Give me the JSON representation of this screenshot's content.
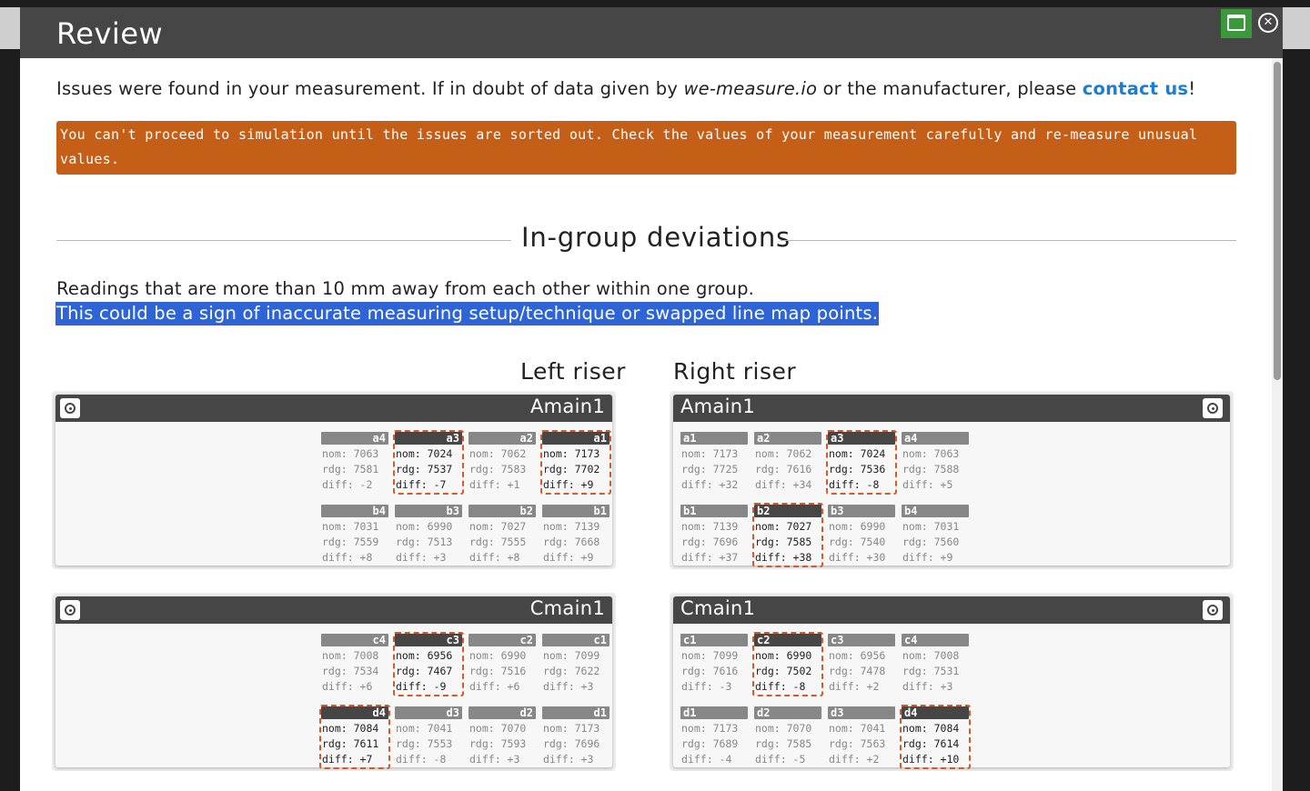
{
  "window": {
    "title": "Review",
    "maximize_icon": "window-maximize-icon",
    "close_icon": "close-circle-icon",
    "accent_green": "#3a9a3a",
    "header_bg": "#464646"
  },
  "intro": {
    "text1": "Issues were found in your measurement. If in doubt of data given by ",
    "source": "we-measure.io",
    "text2": " or the manufacturer, please ",
    "link": "contact us",
    "text3": "!"
  },
  "warning": {
    "text": "You can't proceed to simulation until the issues are sorted out. Check the values of your measurement carefully and re-measure unusual values.",
    "color": "#c55e16"
  },
  "section": {
    "title": "In-group deviations",
    "desc1": "Readings that are more than 10 mm away from each other within one group.",
    "desc2": "This could be a sign of inaccurate measuring setup/technique or swapped line map points."
  },
  "risers": {
    "left": "Left riser",
    "right": "Right riser"
  },
  "panels": {
    "left_amain": {
      "name": "Amain1",
      "rows": [
        [
          {
            "tag": "a4",
            "nom": "nom: 7063",
            "rdg": "rdg: 7581",
            "diff": "diff: -2",
            "bad": false
          },
          {
            "tag": "a3",
            "nom": "nom: 7024",
            "rdg": "rdg: 7537",
            "diff": "diff: -7",
            "bad": true
          },
          {
            "tag": "a2",
            "nom": "nom: 7062",
            "rdg": "rdg: 7583",
            "diff": "diff: +1",
            "bad": false
          },
          {
            "tag": "a1",
            "nom": "nom: 7173",
            "rdg": "rdg: 7702",
            "diff": "diff: +9",
            "bad": true
          }
        ],
        [
          {
            "tag": "b4",
            "nom": "nom: 7031",
            "rdg": "rdg: 7559",
            "diff": "diff: +8",
            "bad": false
          },
          {
            "tag": "b3",
            "nom": "nom: 6990",
            "rdg": "rdg: 7513",
            "diff": "diff: +3",
            "bad": false
          },
          {
            "tag": "b2",
            "nom": "nom: 7027",
            "rdg": "rdg: 7555",
            "diff": "diff: +8",
            "bad": false
          },
          {
            "tag": "b1",
            "nom": "nom: 7139",
            "rdg": "rdg: 7668",
            "diff": "diff: +9",
            "bad": false
          }
        ]
      ]
    },
    "right_amain": {
      "name": "Amain1",
      "rows": [
        [
          {
            "tag": "a1",
            "nom": "nom: 7173",
            "rdg": "rdg: 7725",
            "diff": "diff: +32",
            "bad": false
          },
          {
            "tag": "a2",
            "nom": "nom: 7062",
            "rdg": "rdg: 7616",
            "diff": "diff: +34",
            "bad": false
          },
          {
            "tag": "a3",
            "nom": "nom: 7024",
            "rdg": "rdg: 7536",
            "diff": "diff: -8",
            "bad": true
          },
          {
            "tag": "a4",
            "nom": "nom: 7063",
            "rdg": "rdg: 7588",
            "diff": "diff: +5",
            "bad": false
          }
        ],
        [
          {
            "tag": "b1",
            "nom": "nom: 7139",
            "rdg": "rdg: 7696",
            "diff": "diff: +37",
            "bad": false
          },
          {
            "tag": "b2",
            "nom": "nom: 7027",
            "rdg": "rdg: 7585",
            "diff": "diff: +38",
            "bad": true
          },
          {
            "tag": "b3",
            "nom": "nom: 6990",
            "rdg": "rdg: 7540",
            "diff": "diff: +30",
            "bad": false
          },
          {
            "tag": "b4",
            "nom": "nom: 7031",
            "rdg": "rdg: 7560",
            "diff": "diff: +9",
            "bad": false
          }
        ]
      ]
    },
    "left_cmain": {
      "name": "Cmain1",
      "rows": [
        [
          {
            "tag": "c4",
            "nom": "nom: 7008",
            "rdg": "rdg: 7534",
            "diff": "diff: +6",
            "bad": false
          },
          {
            "tag": "c3",
            "nom": "nom: 6956",
            "rdg": "rdg: 7467",
            "diff": "diff: -9",
            "bad": true
          },
          {
            "tag": "c2",
            "nom": "nom: 6990",
            "rdg": "rdg: 7516",
            "diff": "diff: +6",
            "bad": false
          },
          {
            "tag": "c1",
            "nom": "nom: 7099",
            "rdg": "rdg: 7622",
            "diff": "diff: +3",
            "bad": false
          }
        ],
        [
          {
            "tag": "d4",
            "nom": "nom: 7084",
            "rdg": "rdg: 7611",
            "diff": "diff: +7",
            "bad": true
          },
          {
            "tag": "d3",
            "nom": "nom: 7041",
            "rdg": "rdg: 7553",
            "diff": "diff: -8",
            "bad": false
          },
          {
            "tag": "d2",
            "nom": "nom: 7070",
            "rdg": "rdg: 7593",
            "diff": "diff: +3",
            "bad": false
          },
          {
            "tag": "d1",
            "nom": "nom: 7173",
            "rdg": "rdg: 7696",
            "diff": "diff: +3",
            "bad": false
          }
        ]
      ]
    },
    "right_cmain": {
      "name": "Cmain1",
      "rows": [
        [
          {
            "tag": "c1",
            "nom": "nom: 7099",
            "rdg": "rdg: 7616",
            "diff": "diff: -3",
            "bad": false
          },
          {
            "tag": "c2",
            "nom": "nom: 6990",
            "rdg": "rdg: 7502",
            "diff": "diff: -8",
            "bad": true
          },
          {
            "tag": "c3",
            "nom": "nom: 6956",
            "rdg": "rdg: 7478",
            "diff": "diff: +2",
            "bad": false
          },
          {
            "tag": "c4",
            "nom": "nom: 7008",
            "rdg": "rdg: 7531",
            "diff": "diff: +3",
            "bad": false
          }
        ],
        [
          {
            "tag": "d1",
            "nom": "nom: 7173",
            "rdg": "rdg: 7689",
            "diff": "diff: -4",
            "bad": false
          },
          {
            "tag": "d2",
            "nom": "nom: 7070",
            "rdg": "rdg: 7585",
            "diff": "diff: -5",
            "bad": false
          },
          {
            "tag": "d3",
            "nom": "nom: 7041",
            "rdg": "rdg: 7563",
            "diff": "diff: +2",
            "bad": false
          },
          {
            "tag": "d4",
            "nom": "nom: 7084",
            "rdg": "rdg: 7614",
            "diff": "diff: +10",
            "bad": true
          }
        ]
      ]
    }
  }
}
